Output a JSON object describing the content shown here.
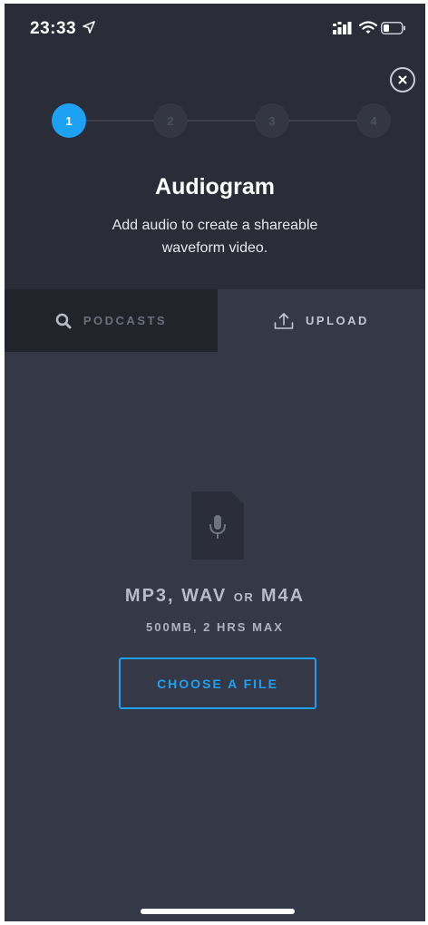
{
  "status_bar": {
    "time": "23:33",
    "icons": [
      "location-arrow-icon",
      "cellular-signal-icon",
      "wifi-icon",
      "battery-icon"
    ]
  },
  "header": {
    "close_icon": "close-icon",
    "steps": [
      "1",
      "2",
      "3",
      "4"
    ],
    "active_step": 1,
    "title": "Audiogram",
    "subtitle": "Add audio to create a shareable waveform video."
  },
  "tabs": [
    {
      "label": "PODCASTS",
      "icon": "search-icon",
      "selected": false
    },
    {
      "label": "UPLOAD",
      "icon": "upload-icon",
      "selected": true
    }
  ],
  "upload": {
    "file_icon": "microphone-file-icon",
    "formats_main_1": "MP3, WAV",
    "formats_or": "OR",
    "formats_main_2": "M4A",
    "limits": "500MB, 2 HRS MAX",
    "button_label": "CHOOSE A FILE"
  },
  "colors": {
    "accent": "#1da1f2",
    "panel_dark": "#2a2d37",
    "background": "#353846",
    "tab_inactive": "#22242c"
  }
}
